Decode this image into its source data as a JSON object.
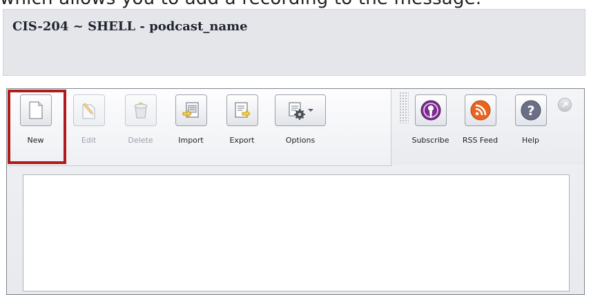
{
  "caption": {
    "text": "which allows you to add a recording to the message."
  },
  "header": {
    "title": "CIS-204 ~ SHELL - podcast_name"
  },
  "toolbar": {
    "new_label": "New",
    "edit_label": "Edit",
    "delete_label": "Delete",
    "import_label": "Import",
    "export_label": "Export",
    "options_label": "Options",
    "subscribe_label": "Subscribe",
    "rss_label": "RSS Feed",
    "help_label": "Help"
  },
  "colors": {
    "highlight": "#b01a1a",
    "rss": "#e8641f",
    "subscribe": "#7b2d8e",
    "help": "#6b6f86"
  },
  "icons": {
    "new": "blank-page-icon",
    "edit": "pencil-page-icon",
    "delete": "trash-icon",
    "import": "import-icon",
    "export": "export-icon",
    "options": "gear-page-icon",
    "subscribe": "podcast-icon",
    "rss": "rss-icon",
    "help": "help-icon",
    "popout": "popout-icon"
  }
}
